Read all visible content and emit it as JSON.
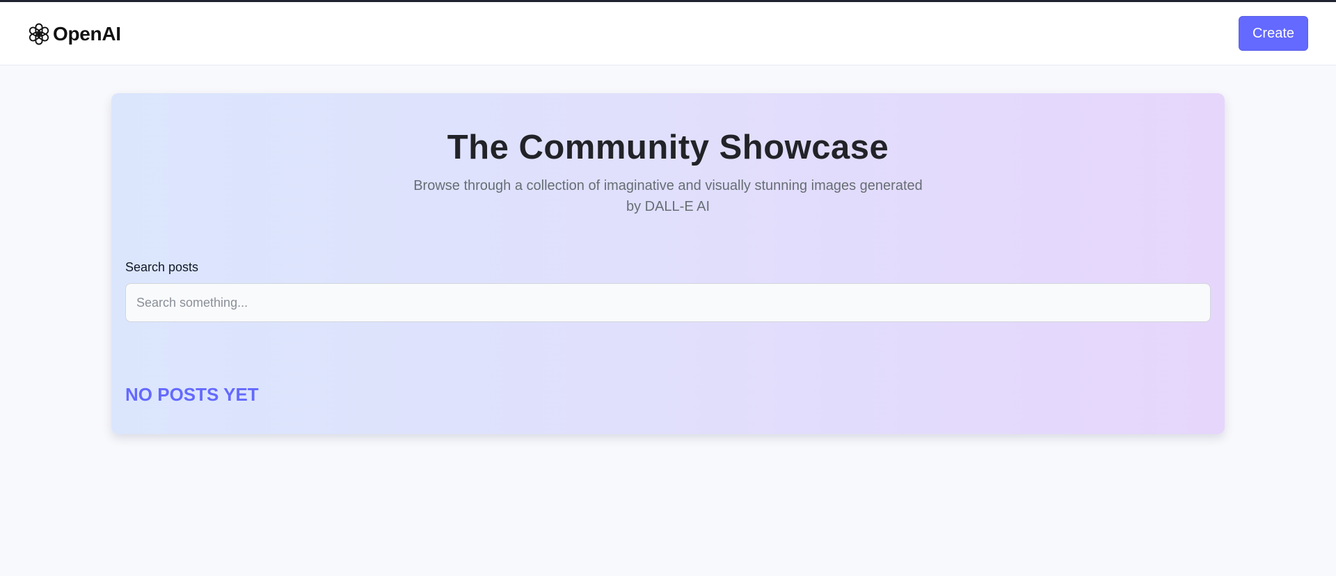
{
  "header": {
    "logo_text": "OpenAI",
    "logo_icon": "openai-logo-icon",
    "create_label": "Create"
  },
  "showcase": {
    "title": "The Community Showcase",
    "subtitle_line1": "Browse through a collection of imaginative and visually stunning images generated",
    "subtitle_line2": "by DALL-E AI",
    "search_label": "Search posts",
    "search_placeholder": "Search something...",
    "search_value": "",
    "empty_message": "NO POSTS YET"
  },
  "colors": {
    "accent": "#6469ff",
    "page_background": "#f8f9fc",
    "card_gradient_start": "#dbe6fd",
    "card_gradient_end": "#e6d6fc",
    "title_text": "#222328",
    "subtitle_text": "#666e75"
  }
}
